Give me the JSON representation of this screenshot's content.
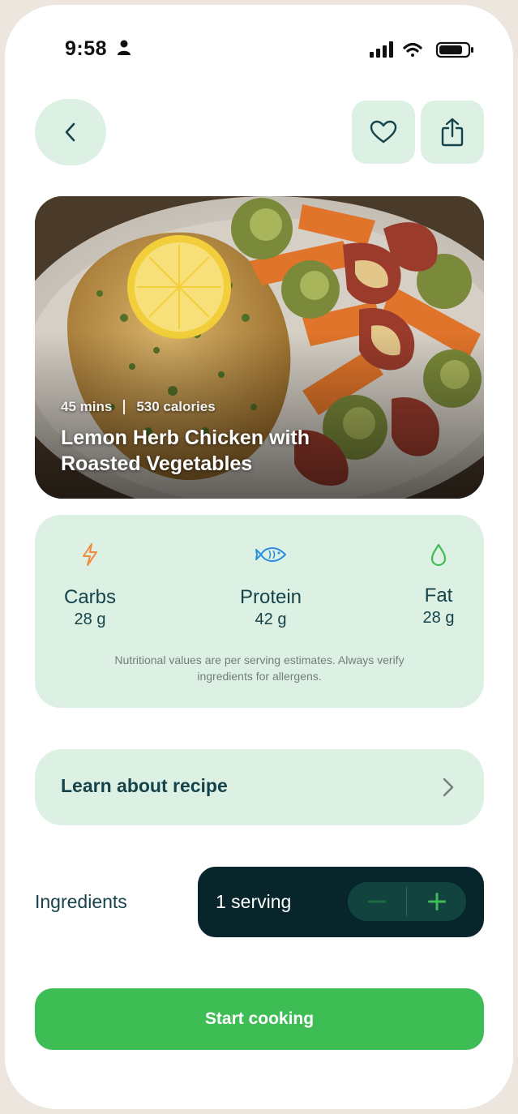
{
  "status_bar": {
    "time": "9:58"
  },
  "icons": {
    "back": "chevron-left-icon",
    "favorite": "heart-icon",
    "share": "share-icon",
    "carbs": "lightning-icon",
    "protein": "fish-icon",
    "fat": "droplet-icon",
    "learn": "chevron-right-icon",
    "minus": "minus-icon",
    "plus": "plus-icon"
  },
  "recipe": {
    "time": "45 mins",
    "calories": "530 calories",
    "title_line1": "Lemon Herb Chicken with",
    "title_line2": "Roasted Vegetables"
  },
  "nutrition": {
    "carbs": {
      "label": "Carbs",
      "value": "28 g"
    },
    "protein": {
      "label": "Protein",
      "value": "42 g"
    },
    "fat": {
      "label": "Fat",
      "value": "28 g"
    },
    "note_line1": "Nutritional values are per serving estimates. Always verify",
    "note_line2": "ingredients for allergens."
  },
  "learn": {
    "label": "Learn about recipe"
  },
  "ingredients": {
    "label": "Ingredients",
    "serving": "1 serving"
  },
  "actions": {
    "start_cooking": "Start cooking"
  },
  "colors": {
    "accent_green": "#3ebd55",
    "card_mint": "#dcf1e4",
    "dark_teal": "#07252a",
    "text_teal": "#16434a",
    "carbs_icon": "#f08a3c",
    "protein_icon": "#2b8fe0",
    "fat_icon": "#3ebd55"
  }
}
